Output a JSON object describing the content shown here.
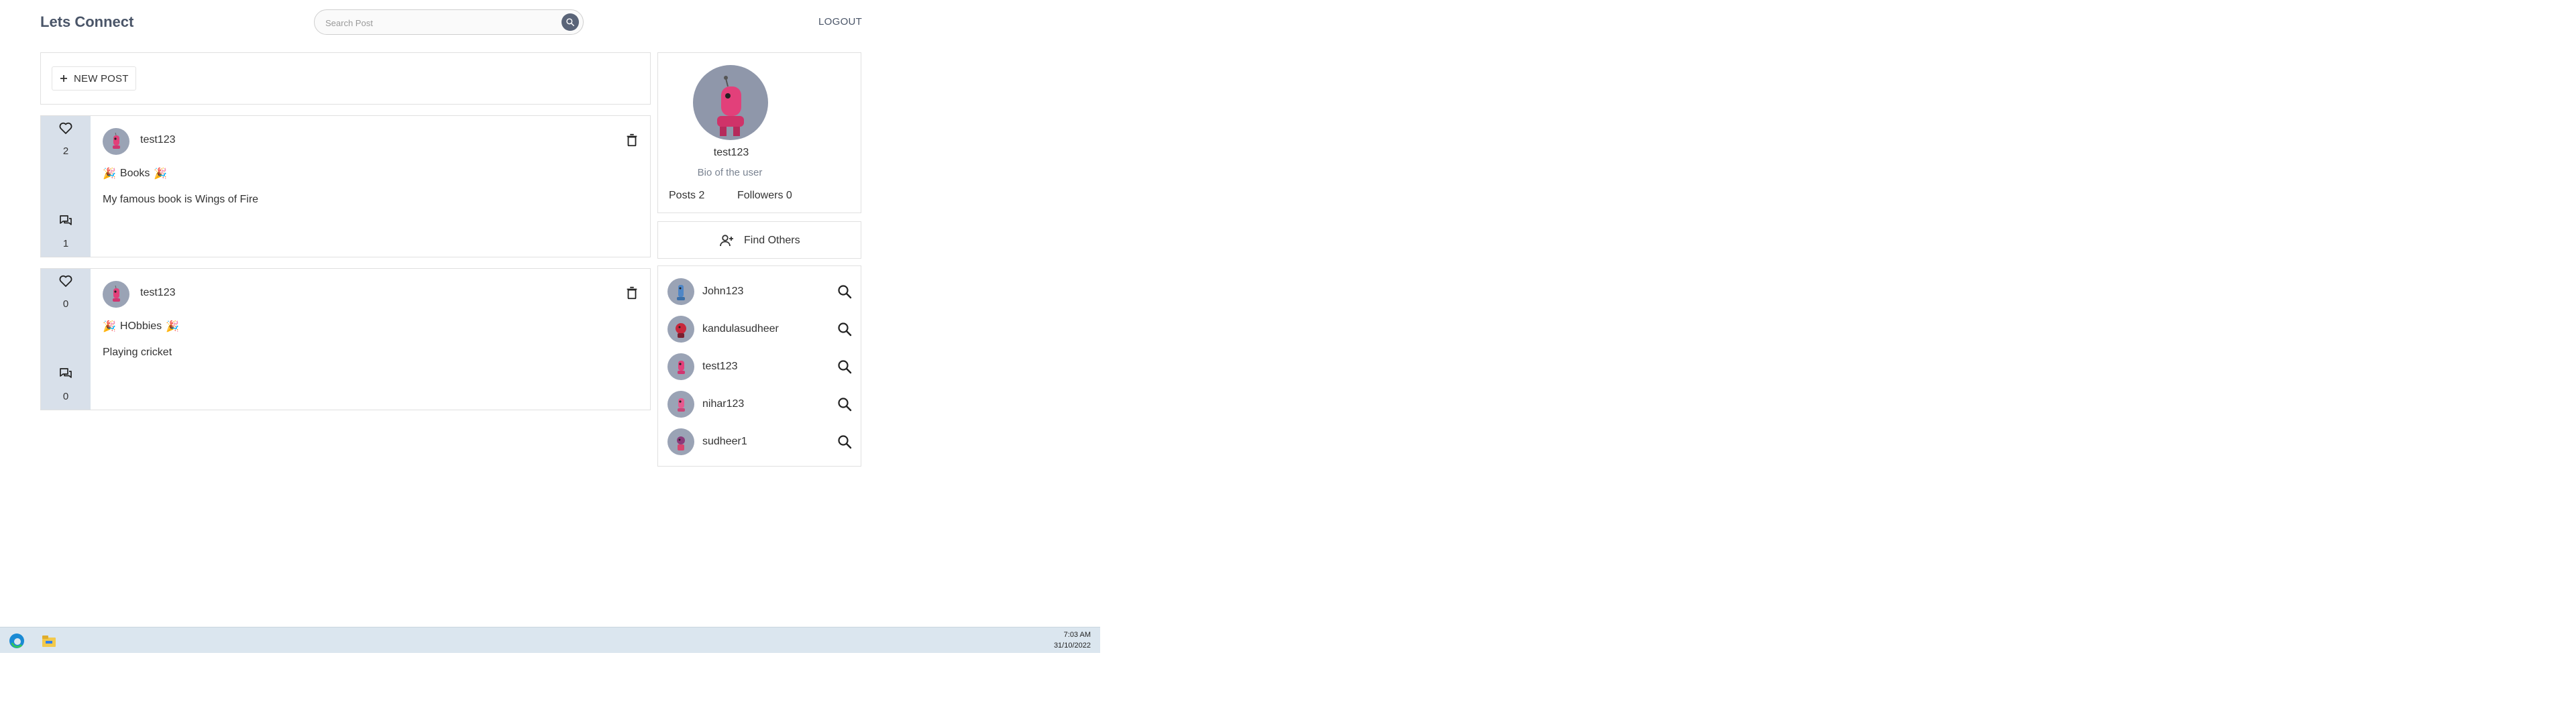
{
  "header": {
    "app_title": "Lets Connect",
    "search_placeholder": "Search Post",
    "logout_label": "LOGOUT"
  },
  "composer": {
    "new_post_label": "NEW POST"
  },
  "posts": [
    {
      "likes": "2",
      "comments": "1",
      "author": "test123",
      "title": "Books",
      "body": "My famous book is Wings of Fire"
    },
    {
      "likes": "0",
      "comments": "0",
      "author": "test123",
      "title": "HObbies",
      "body": "Playing cricket"
    }
  ],
  "profile": {
    "name": "test123",
    "bio": "Bio of the user",
    "posts_stat": "Posts 2",
    "followers_stat": "Followers 0"
  },
  "find_others_label": "Find Others",
  "users": [
    {
      "name": "John123"
    },
    {
      "name": "kandulasudheer"
    },
    {
      "name": "test123"
    },
    {
      "name": "nihar123"
    },
    {
      "name": "sudheer1"
    }
  ],
  "taskbar": {
    "time": "7:03 AM",
    "date": "31/10/2022"
  },
  "colors": {
    "accent": "#4a5568",
    "sidebar": "#d8e0ea",
    "avatar_bg": "#9aa3b5",
    "robot_pink": "#e2407a"
  }
}
